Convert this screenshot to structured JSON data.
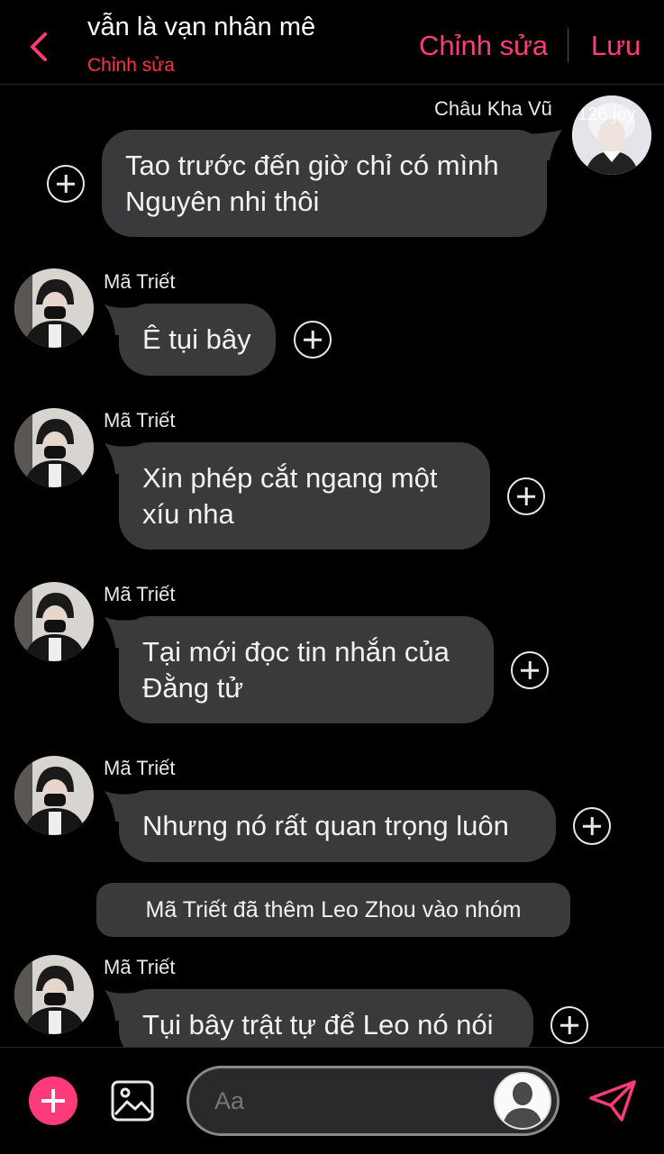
{
  "header": {
    "title": "vẫn là vạn nhân mê",
    "subtitle": "Chỉnh sửa",
    "edit_label": "Chỉnh sửa",
    "save_label": "Lưu"
  },
  "messages": [
    {
      "sender": "Châu Kha Vũ",
      "text_lines": [
        "Tao trước đến giờ chỉ có mình",
        "Nguyên nhi thôi"
      ],
      "side": "right"
    },
    {
      "sender": "Mã Triết",
      "text_lines": [
        "Ê tụi bây"
      ],
      "side": "left"
    },
    {
      "sender": "Mã Triết",
      "text_lines": [
        "Xin phép cắt ngang một",
        "xíu nha"
      ],
      "side": "left"
    },
    {
      "sender": "Mã Triết",
      "text_lines": [
        "Tại mới đọc tin nhắn của",
        "Đằng tử"
      ],
      "side": "left"
    },
    {
      "sender": "Mã Triết",
      "text_lines": [
        "Nhưng nó rất quan trọng luôn"
      ],
      "side": "left"
    },
    {
      "sender": "Mã Triết",
      "text_lines": [
        "Tụi bây trật tự để Leo nó nói"
      ],
      "side": "left"
    }
  ],
  "system_message": "Mã Triết đã thêm Leo Zhou vào nhóm",
  "avatar_watermark": "126 joy",
  "composer": {
    "placeholder": "Aa"
  },
  "colors": {
    "accent": "#ff3a7a",
    "subtitle": "#ff3344",
    "bubble": "#3a3a3c",
    "background": "#000000"
  },
  "icons": [
    "chevron-left-icon",
    "plus-circle-icon",
    "image-icon",
    "send-icon",
    "person-silhouette-icon"
  ]
}
